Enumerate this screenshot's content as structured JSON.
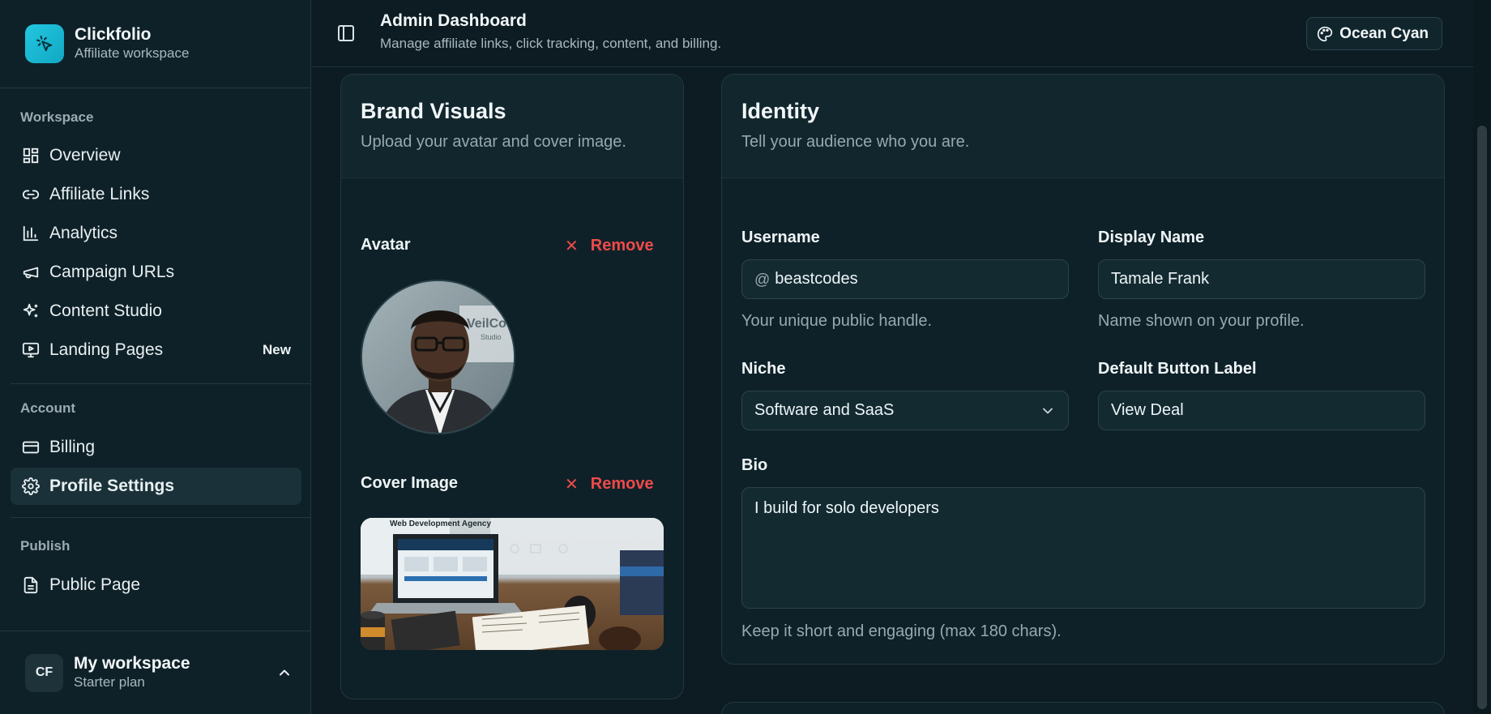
{
  "brand": {
    "name": "Clickfolio",
    "subtitle": "Affiliate workspace"
  },
  "sidebar": {
    "sections": [
      {
        "label": "Workspace"
      },
      {
        "label": "Account"
      },
      {
        "label": "Publish"
      }
    ],
    "items": [
      {
        "label": "Overview",
        "icon": "dashboard-icon"
      },
      {
        "label": "Affiliate Links",
        "icon": "link-icon"
      },
      {
        "label": "Analytics",
        "icon": "bar-chart-icon"
      },
      {
        "label": "Campaign URLs",
        "icon": "megaphone-icon"
      },
      {
        "label": "Content Studio",
        "icon": "sparkles-icon"
      },
      {
        "label": "Landing Pages",
        "icon": "presentation-icon",
        "badge": "New"
      },
      {
        "label": "Billing",
        "icon": "credit-card-icon"
      },
      {
        "label": "Profile Settings",
        "icon": "gear-icon",
        "active": true
      },
      {
        "label": "Public Page",
        "icon": "document-icon"
      }
    ],
    "workspace": {
      "initials": "CF",
      "name": "My workspace",
      "plan": "Starter plan"
    }
  },
  "header": {
    "title": "Admin Dashboard",
    "subtitle": "Manage affiliate links, click tracking, content, and billing.",
    "theme_label": "Ocean Cyan"
  },
  "brand_visuals": {
    "title": "Brand Visuals",
    "subtitle": "Upload your avatar and cover image.",
    "avatar_label": "Avatar",
    "avatar_photo_text": "VeilCod",
    "avatar_photo_subtext": "Studio",
    "cover_label": "Cover Image",
    "cover_photo_text": "Web Development Agency",
    "remove_label": "Remove"
  },
  "identity": {
    "title": "Identity",
    "subtitle": "Tell your audience who you are.",
    "username": {
      "label": "Username",
      "prefix": "@",
      "value": "beastcodes",
      "help": "Your unique public handle."
    },
    "display_name": {
      "label": "Display Name",
      "value": "Tamale Frank",
      "help": "Name shown on your profile."
    },
    "niche": {
      "label": "Niche",
      "value": "Software and SaaS"
    },
    "button_label": {
      "label": "Default Button Label",
      "value": "View Deal"
    },
    "bio": {
      "label": "Bio",
      "value": "I build for solo developers",
      "help": "Keep it short and engaging (max 180 chars)."
    }
  },
  "colors": {
    "accent": "#1fc0da",
    "danger": "#ef4a4a",
    "background": "#0c1c22",
    "panel": "#0f2128"
  }
}
